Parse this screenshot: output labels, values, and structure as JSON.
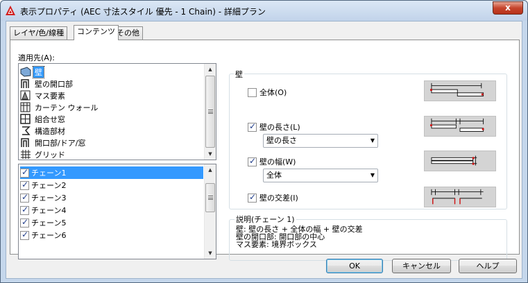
{
  "window": {
    "title": "表示プロパティ (AEC 寸法スタイル 優先 - 1 Chain) - 詳細プラン",
    "close_label": "x"
  },
  "tabs": [
    {
      "label": "レイヤ/色/線種",
      "active": false
    },
    {
      "label": "コンテンツ",
      "active": true
    },
    {
      "label": "その他",
      "active": false
    }
  ],
  "apply_to": {
    "label": "適用先(A):",
    "items": [
      {
        "label": "壁",
        "icon": "wall-icon",
        "selected": true
      },
      {
        "label": "壁の開口部",
        "icon": "wall-opening-icon"
      },
      {
        "label": "マス要素",
        "icon": "mass-element-icon"
      },
      {
        "label": "カーテン ウォール",
        "icon": "curtain-wall-icon"
      },
      {
        "label": "組合せ窓",
        "icon": "window-assembly-icon"
      },
      {
        "label": "構造部材",
        "icon": "structural-member-icon"
      },
      {
        "label": "開口部/ドア/窓",
        "icon": "door-window-icon"
      },
      {
        "label": "グリッド",
        "icon": "grid-icon"
      }
    ]
  },
  "chains": {
    "items": [
      {
        "label": "チェーン1",
        "checked": true,
        "selected": true
      },
      {
        "label": "チェーン2",
        "checked": true
      },
      {
        "label": "チェーン3",
        "checked": true
      },
      {
        "label": "チェーン4",
        "checked": true
      },
      {
        "label": "チェーン5",
        "checked": true
      },
      {
        "label": "チェーン6",
        "checked": true
      }
    ]
  },
  "wall_group": {
    "title": "壁",
    "overall": {
      "label": "全体(O)",
      "checked": false
    },
    "length": {
      "label": "壁の長さ(L)",
      "checked": true,
      "combo_value": "壁の長さ"
    },
    "width": {
      "label": "壁の幅(W)",
      "checked": true,
      "combo_value": "全体"
    },
    "intersection": {
      "label": "壁の交差(I)",
      "checked": true
    }
  },
  "description": {
    "title": "説明(チェーン 1)",
    "lines": [
      "壁: 壁の長さ + 全体の幅 + 壁の交差",
      "壁の開口部: 開口部の中心",
      "マス要素: 境界ボックス"
    ]
  },
  "buttons": {
    "ok": "OK",
    "cancel": "キャンセル",
    "help": "ヘルプ"
  },
  "colors": {
    "selection": "#3399ff",
    "title_bar": "#c5d7ec",
    "close_button": "#c6452d"
  }
}
